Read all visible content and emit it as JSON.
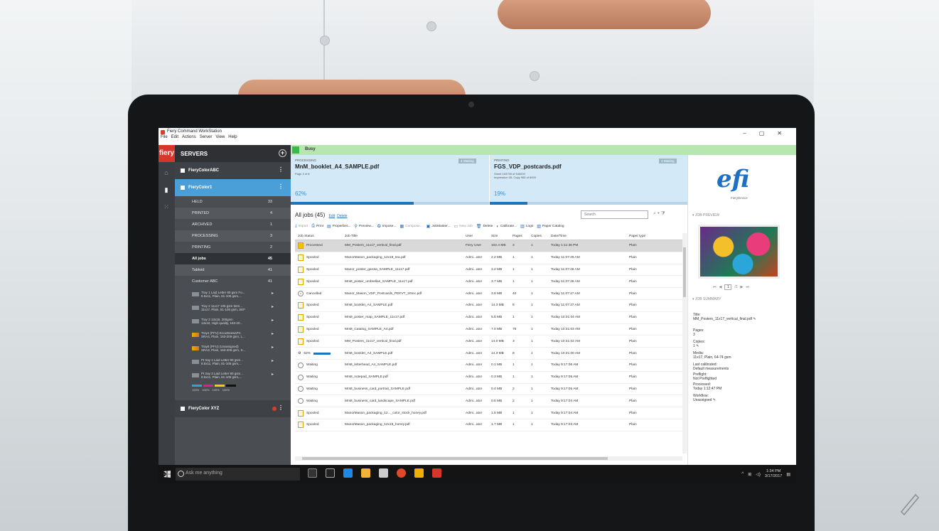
{
  "window": {
    "title": "Fiery Command WorkStation",
    "menu": [
      "File",
      "Edit",
      "Actions",
      "Server",
      "View",
      "Help"
    ],
    "controls": [
      "–",
      "▢",
      "✕"
    ]
  },
  "sidebar": {
    "logo_text": "fiery",
    "header": "SERVERS",
    "servers": [
      {
        "name": "FieryColorABC"
      },
      {
        "name": "FieryColor1"
      },
      {
        "name": "FieryColor XYZ"
      }
    ],
    "queues": [
      {
        "label": "HELD",
        "count": "33"
      },
      {
        "label": "PRINTED",
        "count": "4"
      },
      {
        "label": "ARCHIVED",
        "count": "1"
      },
      {
        "label": "PROCESSING",
        "count": "3"
      },
      {
        "label": "PRINTING",
        "count": "2"
      },
      {
        "label": "All jobs",
        "count": "45"
      },
      {
        "label": "Tabloid",
        "count": "41"
      },
      {
        "label": "Customer ABC",
        "count": "41"
      }
    ],
    "media": [
      {
        "line1": "Tray 1 Laid Letter 90 gsm Fo...",
        "line2": "8.5x11, Plain, 81-105 gsm,..."
      },
      {
        "line1": "Tray 2 11x17 105 gsm Item...",
        "line2": "11x17, Plain, 81-105 gsm, SEF"
      },
      {
        "line1": "Tray 3 13x19, 200gsm",
        "line2": "13x19, High quality, 163-20..."
      },
      {
        "line1": "Tray4 (PFU) EcoxDeewsPC",
        "line2": "SRA4, Plain, 163-209 gsm, L..."
      },
      {
        "line1": "Tray5 (PFU) (Unassigned)",
        "line2": "SRA3, Plain, 163-209 gsm, S..."
      },
      {
        "line1": "PI tray 1 Laid Letter 90 gsm...",
        "line2": "8.5x11, Plain, 81-105 gsm,..."
      },
      {
        "line1": "PI tray 2 Laid Letter 90 gsm...",
        "line2": "8.5x11, Plain, 81-105 gsm,..."
      }
    ],
    "ink_levels": [
      "100%",
      "100%",
      "100%",
      "100%"
    ]
  },
  "status": {
    "text": "Busy"
  },
  "processing": {
    "caption": "PROCESSING",
    "job": "MnM_booklet_A4_SAMPLE.pdf",
    "sub": "Page 3 of 8",
    "badge": "4 Waiting",
    "percent": "62%",
    "progress": 0.62
  },
  "printing": {
    "caption": "PRINTING",
    "job": "FGS_VDP_postcards.pdf",
    "sub": "Sheet 103795 of 540000",
    "sub2": "Impression 45, Copy 965 of 6000",
    "badge": "1 Waiting",
    "percent": "19%",
    "progress": 0.19
  },
  "jobs": {
    "title": "All jobs (45)",
    "edit": "Edit",
    "delete": "Delete",
    "search_placeholder": "Search",
    "toolbar": [
      "Import",
      "Print",
      "Properties...",
      "Preview...",
      "Impose...",
      "Compose...",
      "JobMaster...",
      "New Job",
      "Delete",
      "Calibrate...",
      "Logs",
      "Paper Catalog"
    ],
    "columns": [
      "Job Status",
      "Job Title",
      "User",
      "Size",
      "Pages",
      "Copies",
      "Date/Time",
      "Paper type"
    ],
    "rows": [
      {
        "status": "Processed",
        "title": "MM_Posters_11x17_vertical_final.pdf",
        "user": "Fiery User",
        "size": "102.4 MB",
        "pages": "3",
        "copies": "1",
        "date": "Today 1:11:36 PM",
        "paper": "Plain"
      },
      {
        "status": "Spooled",
        "title": "ManorMason_packaging_12x18_tea.pdf",
        "user": "Admi...ator",
        "size": "2.2 MB",
        "pages": "1",
        "copies": "1",
        "date": "Today 11:07:49 AM",
        "paper": "Plain"
      },
      {
        "status": "Spooled",
        "title": "Manor_poster_garota_SAMPLE_11x17.pdf",
        "user": "Admi...ator",
        "size": "3.2 MB",
        "pages": "1",
        "copies": "1",
        "date": "Today 11:07:48 AM",
        "paper": "Plain"
      },
      {
        "status": "Spooled",
        "title": "MnM_poster_umbrellas_SAMPLE_11x17.pdf",
        "user": "Admi...ator",
        "size": "3.7 MB",
        "pages": "1",
        "copies": "1",
        "date": "Today 11:07:48 AM",
        "paper": "Plain"
      },
      {
        "status": "Cancelled",
        "title": "Manor_Mason_VDP_Postcards_PDFVT_20rec.pdf",
        "user": "Admi...ator",
        "size": "3.8 MB",
        "pages": "40",
        "copies": "1",
        "date": "Today 11:07:47 AM",
        "paper": "Plain"
      },
      {
        "status": "Spooled",
        "title": "MnM_booklet_A4_SAMPLE.pdf",
        "user": "Admi...ator",
        "size": "14.3 MB",
        "pages": "8",
        "copies": "1",
        "date": "Today 11:07:37 AM",
        "paper": "Plain"
      },
      {
        "status": "Spooled",
        "title": "MnM_poster_map_SAMPLE_11x17.pdf",
        "user": "Admi...ator",
        "size": "5.5 MB",
        "pages": "1",
        "copies": "1",
        "date": "Today 10:31:04 AM",
        "paper": "Plain"
      },
      {
        "status": "Spooled",
        "title": "MnM_Catalog_SAMPLE_A4.pdf",
        "user": "Admi...ator",
        "size": "7.0 MB",
        "pages": "78",
        "copies": "1",
        "date": "Today 10:31:03 AM",
        "paper": "Plain"
      },
      {
        "status": "Spooled",
        "title": "MM_Posters_11x17_vertical_final.pdf",
        "user": "Admi...ator",
        "size": "14.0 MB",
        "pages": "3",
        "copies": "1",
        "date": "Today 10:31:02 AM",
        "paper": "Plain"
      },
      {
        "status": "62%",
        "title": "MnM_booklet_A4_SAMPLE.pdf",
        "user": "Admi...ator",
        "size": "14.3 MB",
        "pages": "8",
        "copies": "1",
        "date": "Today 10:31:00 AM",
        "paper": "Plain"
      },
      {
        "status": "Waiting",
        "title": "MnM_letterhead_A4_SAMPLE.pdf",
        "user": "Admi...ator",
        "size": "0.1 MB",
        "pages": "1",
        "copies": "1",
        "date": "Today 9:17:06 AM",
        "paper": "Plain"
      },
      {
        "status": "Waiting",
        "title": "MnM_notepad_SAMPLE.pdf",
        "user": "Admi...ator",
        "size": "0.3 MB",
        "pages": "1",
        "copies": "1",
        "date": "Today 9:17:05 AM",
        "paper": "Plain"
      },
      {
        "status": "Waiting",
        "title": "MnM_business_card_portrait_SAMPLE.pdf",
        "user": "Admi...ator",
        "size": "0.4 MB",
        "pages": "2",
        "copies": "1",
        "date": "Today 9:17:05 AM",
        "paper": "Plain"
      },
      {
        "status": "Waiting",
        "title": "MnM_business_card_landscape_SAMPLE.pdf",
        "user": "Admi...ator",
        "size": "0.6 MB",
        "pages": "2",
        "copies": "1",
        "date": "Today 9:17:04 AM",
        "paper": "Plain"
      },
      {
        "status": "Spooled",
        "title": "ManorMason_packaging_12..._color_stock_honey.pdf",
        "user": "Admi...ator",
        "size": "1.5 MB",
        "pages": "1",
        "copies": "1",
        "date": "Today 9:17:04 AM",
        "paper": "Plain"
      },
      {
        "status": "Spooled",
        "title": "ManorMason_packaging_12x18_honey.pdf",
        "user": "Admi...ator",
        "size": "1.7 MB",
        "pages": "1",
        "copies": "1",
        "date": "Today 9:17:03 AM",
        "paper": "Plain"
      }
    ]
  },
  "right_panel": {
    "brand": "efi",
    "brand_sub": "FieryDevice",
    "preview_title": "JOB PREVIEW",
    "page_box": "1",
    "page_total": "/3",
    "summary_title": "JOB SUMMARY",
    "summary": [
      {
        "label": "Title:",
        "value": "MM_Posters_11x17_vertical_final.pdf"
      },
      {
        "label": "Pages:",
        "value": "3"
      },
      {
        "label": "Copies:",
        "value": "1"
      },
      {
        "label": "Media:",
        "value": "11x17, Plain, 64-74 gsm"
      },
      {
        "label": "Last calibrated:",
        "value": "Default measurements"
      },
      {
        "label": "Preflight:",
        "value": "Not Preflighted"
      },
      {
        "label": "Processed:",
        "value": "Today 1:12:47 PM"
      },
      {
        "label": "Workflow:",
        "value": "Unassigned"
      }
    ]
  },
  "taskbar": {
    "search_placeholder": "Ask me anything",
    "time": "1:34 PM",
    "date": "3/17/2017"
  },
  "colors": {
    "accent": "#1f74b8",
    "brand_red": "#d9362b",
    "busy_green": "#3cb84a",
    "efi_blue": "#1d70c2"
  }
}
